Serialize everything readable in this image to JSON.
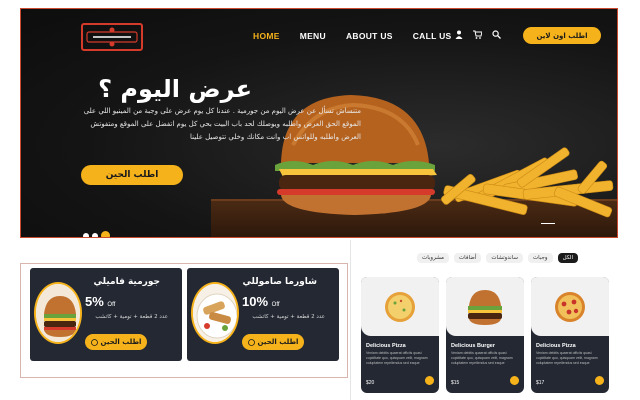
{
  "nav": {
    "items": [
      {
        "label": "HOME",
        "active": true
      },
      {
        "label": "MENU",
        "active": false
      },
      {
        "label": "ABOUT US",
        "active": false
      },
      {
        "label": "CALL US",
        "active": false
      }
    ],
    "icons": [
      "user-icon",
      "cart-icon",
      "search-icon"
    ],
    "order_online_label": "اطلب اون لاين"
  },
  "hero": {
    "title": "عرض اليوم ؟",
    "description": "متنساش تسأل عن عرض اليوم من جورمية . عندنا كل يوم عرض على وجبة من المينيو اللي على الموقع الحق العرض واطلبه ويوصلك لحد باب البيت بحي كل يوم اتفضل على الموقع ومتفوتش العرض واطلبه وللواتس اب وانت مكانك وخلي تتوصيل علينا",
    "button_label": "اطلب الحين",
    "slides": 3,
    "active_slide": 3
  },
  "offers": [
    {
      "title": "جورمية فاميلي",
      "percent": "5%",
      "off": "Off",
      "details": "عدد 2 قطعة + تومية + كاتشب",
      "button_label": "اطلب الحين"
    },
    {
      "title": "شاورما صاموللي",
      "percent": "10%",
      "off": "Off",
      "details": "عدد 2 قطعة + تومية + كاتشب",
      "button_label": "اطلب الحين"
    }
  ],
  "filters": [
    {
      "label": "الكل",
      "active": true
    },
    {
      "label": "وجبات",
      "active": false
    },
    {
      "label": "ساندوتشات",
      "active": false
    },
    {
      "label": "أضافات",
      "active": false
    },
    {
      "label": "مشروبات",
      "active": false
    }
  ],
  "products": [
    {
      "name": "Delicious Pizza",
      "desc": "Veniam debitis quaerat officiis quasi cupiditate quo, quisquam velit, magnam voluptatem repellendus sed eaque",
      "price": "$20",
      "image": "pizza-plain"
    },
    {
      "name": "Delicious Burger",
      "desc": "Veniam debitis quaerat officiis quasi cupiditate quo, quisquam velit, magnam voluptatem repellendus sed eaque",
      "price": "$15",
      "image": "burger"
    },
    {
      "name": "Delicious Pizza",
      "desc": "Veniam debitis quaerat officiis quasi cupiditate quo, quisquam velit, magnam voluptatem repellendus sed eaque",
      "price": "$17",
      "image": "pizza-pepperoni"
    }
  ],
  "colors": {
    "accent": "#f5b21b",
    "dark": "#1b1b1b",
    "card": "#232833"
  }
}
